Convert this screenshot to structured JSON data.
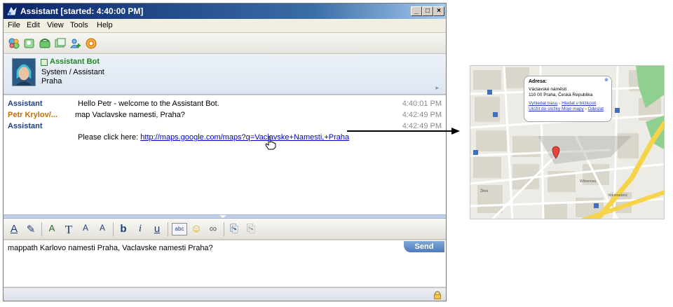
{
  "window": {
    "title": "Assistant [started: 4:40:00 PM]",
    "controls": {
      "minimize": "_",
      "maximize": "□",
      "close": "×"
    }
  },
  "menu": [
    "File",
    "Edit",
    "View",
    "Tools",
    "Help"
  ],
  "toolbar_icons": [
    "buddies-icon",
    "contacts-icon",
    "phone-icon",
    "cards-icon",
    "add-user-icon",
    "mail-icon"
  ],
  "contact": {
    "name": "Assistant Bot",
    "subtitle": "System / Assistant",
    "city": "Praha"
  },
  "messages": [
    {
      "sender": "Assistant",
      "sender_color": "#1f3f84",
      "text": "Hello Petr - welcome to the Assistant Bot.",
      "time": "4:40:01 PM"
    },
    {
      "sender": "Petr Krylov/...",
      "sender_color": "#c56b00",
      "text": "map Vaclavske namesti, Praha?",
      "time": "4:42:49 PM"
    },
    {
      "sender": "Assistant",
      "sender_color": "#1f3f84",
      "text": "",
      "time": "4:42:49 PM"
    }
  ],
  "link_message": {
    "prefix": "Please click here: ",
    "url": "http://maps.google.com/maps?q=Vaclavske+Namesti,+Praha"
  },
  "format_toolbar": [
    "A",
    "✎",
    "A",
    "T",
    "A",
    "A",
    "b",
    "i",
    "u",
    "abc",
    "☺",
    "∞",
    "⎘",
    "⎘"
  ],
  "input": {
    "text": "mappath Karlovo namesti Praha, Vaclavske namesti Praha?",
    "send_label": "Send"
  },
  "map": {
    "popup_title": "Adresa:",
    "address_line1": "Václavské náměstí",
    "address_line2": "110 00 Praha, Česká Republika",
    "link1": "Vyhledat trasu",
    "link1_sep": " - ",
    "link2": "Hledat v blízkosti",
    "link3": "Uložit do složky Moje mapy",
    "link3_sep": " - ",
    "link4": "Odeslat",
    "close": "⊗",
    "label_wilsonova": "Wilsonova",
    "label_vinohradska": "Vinohradská",
    "label_zitna": "Žitná"
  },
  "colors": {
    "title_gradient_start": "#0a246a",
    "contact_name": "#21871e",
    "link": "#0000cc",
    "send_button": "#4d7cbc",
    "map_road_major": "#f6d44a"
  }
}
